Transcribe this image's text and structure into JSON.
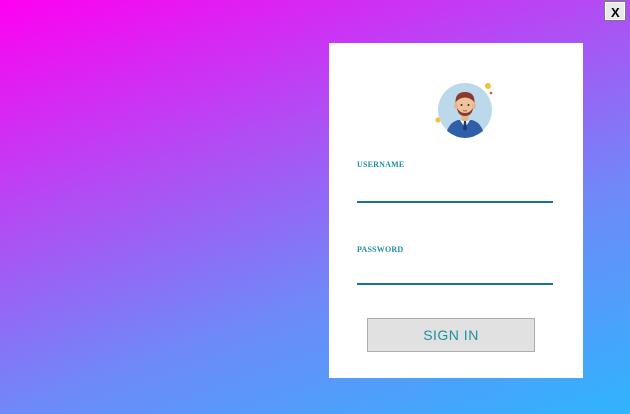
{
  "window": {
    "close_label": "X"
  },
  "login": {
    "avatar_icon": "user-avatar-icon",
    "username_label": "USERNAME",
    "username_value": "",
    "password_label": "PASSWORD",
    "password_value": "",
    "signin_label": "SIGN IN"
  },
  "colors": {
    "gradient_start": "#ff00f2",
    "gradient_end": "#2fb4fd",
    "label_color": "#1f8fa0",
    "underline_color": "#1b6f9e",
    "button_bg": "#e1e1e1"
  }
}
